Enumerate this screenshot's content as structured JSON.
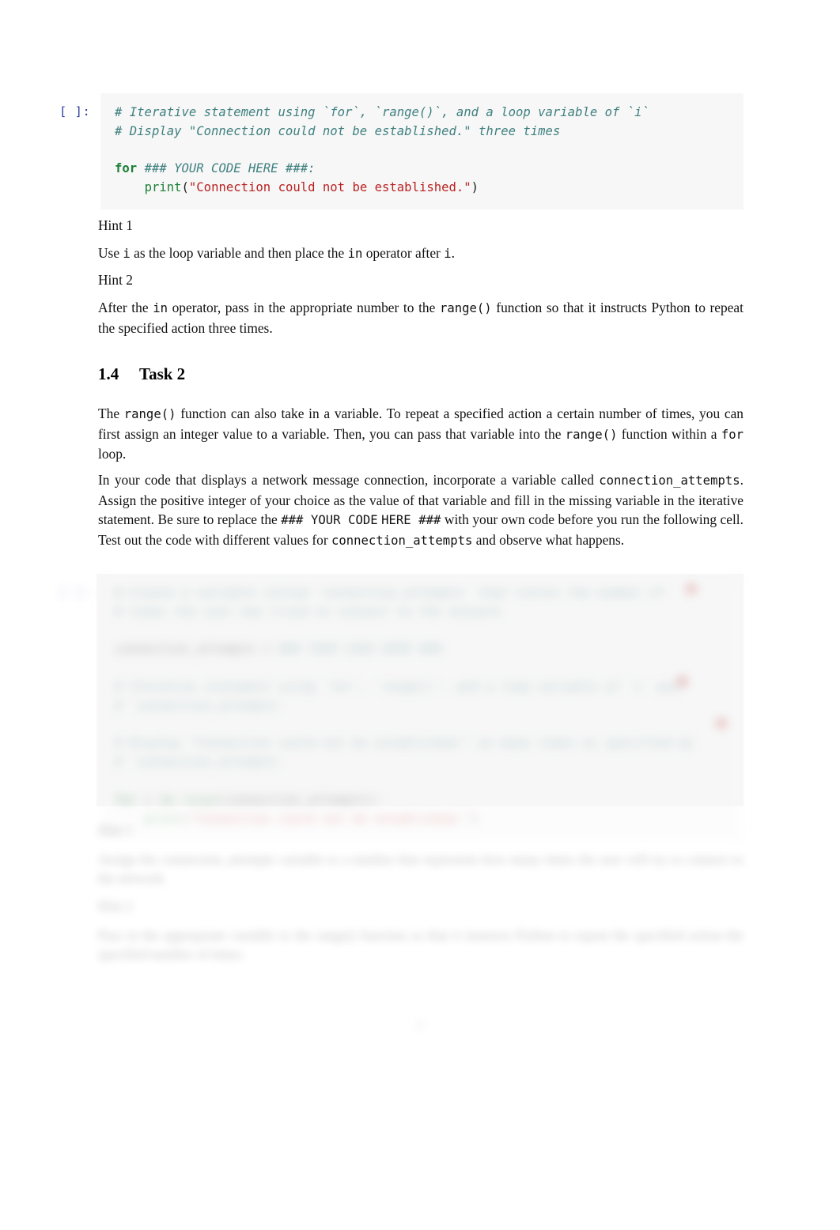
{
  "document": {
    "kind": "jupyter-notebook-pdf-export",
    "page_number": "2"
  },
  "cell1": {
    "prompt": "[ ]:",
    "lines": [
      {
        "segments": [
          {
            "type": "comment",
            "text": "# Iterative statement using `for`, `range()`, and a loop variable of `i`"
          }
        ]
      },
      {
        "segments": [
          {
            "type": "comment",
            "text": "# Display \"Connection could not be established.\" three times"
          }
        ]
      },
      {
        "segments": [
          {
            "type": "plain",
            "text": ""
          }
        ]
      },
      {
        "segments": [
          {
            "type": "keyword",
            "text": "for"
          },
          {
            "type": "plain",
            "text": " "
          },
          {
            "type": "comment",
            "text": "### YOUR CODE HERE ###:"
          }
        ]
      },
      {
        "segments": [
          {
            "type": "plain",
            "text": "    "
          },
          {
            "type": "function",
            "text": "print"
          },
          {
            "type": "plain",
            "text": "("
          },
          {
            "type": "string",
            "text": "\"Connection could not be established.\""
          },
          {
            "type": "plain",
            "text": ")"
          }
        ]
      }
    ]
  },
  "hint1": {
    "title": "Hint 1",
    "body_parts": [
      {
        "type": "text",
        "text": "Use "
      },
      {
        "type": "code",
        "text": "i"
      },
      {
        "type": "text",
        "text": " as the loop variable and then place the "
      },
      {
        "type": "code",
        "text": "in"
      },
      {
        "type": "text",
        "text": " operator after "
      },
      {
        "type": "code",
        "text": "i"
      },
      {
        "type": "text",
        "text": "."
      }
    ]
  },
  "hint2": {
    "title": "Hint 2",
    "body_parts": [
      {
        "type": "text",
        "text": "After the "
      },
      {
        "type": "code",
        "text": "in"
      },
      {
        "type": "text",
        "text": " operator, pass in the appropriate number to the "
      },
      {
        "type": "code",
        "text": "range()"
      },
      {
        "type": "text",
        "text": " function so that it instructs Python to repeat the specified action three times."
      }
    ]
  },
  "section": {
    "number": "1.4",
    "title": "Task 2"
  },
  "para1": {
    "parts": [
      {
        "type": "text",
        "text": "The "
      },
      {
        "type": "code",
        "text": "range()"
      },
      {
        "type": "text",
        "text": " function can also take in a variable. To repeat a specified action a certain number of times, you can first assign an integer value to a variable. Then, you can pass that variable into the "
      },
      {
        "type": "code",
        "text": "range()"
      },
      {
        "type": "text",
        "text": " function within a "
      },
      {
        "type": "code",
        "text": "for"
      },
      {
        "type": "text",
        "text": " loop."
      }
    ]
  },
  "para2": {
    "parts": [
      {
        "type": "text",
        "text": "In your code that displays a network message connection, incorporate a variable called "
      },
      {
        "type": "code",
        "text": "connection_attempts"
      },
      {
        "type": "text",
        "text": ". Assign the positive integer of your choice as the value of that variable and fill in the missing variable in the iterative statement. Be sure to replace the "
      },
      {
        "type": "code",
        "text": "### YOUR CODE"
      },
      {
        "type": "text",
        "text": " "
      },
      {
        "type": "code",
        "text": "HERE ###"
      },
      {
        "type": "text",
        "text": " with your own code before you run the following cell. Test out the code with different values for "
      },
      {
        "type": "code",
        "text": "connection_attempts"
      },
      {
        "type": "text",
        "text": " and observe what happens."
      }
    ]
  },
  "redacted": {
    "note": "blurred-content",
    "cell": {
      "prompt": "[ ]:",
      "lines": [
        {
          "segments": [
            {
              "type": "comment",
              "text": "# Create a variable called `connection_attempts` that stores the number of"
            }
          ]
        },
        {
          "segments": [
            {
              "type": "comment",
              "text": "# times the user has tried to connect to the network"
            }
          ]
        },
        {
          "segments": [
            {
              "type": "plain",
              "text": ""
            }
          ]
        },
        {
          "segments": [
            {
              "type": "plain",
              "text": "connection_attempts"
            },
            {
              "type": "plain",
              "text": " = "
            },
            {
              "type": "comment",
              "text": "### YOUR CODE HERE ###"
            }
          ]
        },
        {
          "segments": [
            {
              "type": "plain",
              "text": ""
            }
          ]
        },
        {
          "segments": [
            {
              "type": "comment",
              "text": "# Iterative statement using `for`, `range()`, and a loop variable of `i` and"
            }
          ]
        },
        {
          "segments": [
            {
              "type": "comment",
              "text": "# `connection_attempts`"
            }
          ]
        },
        {
          "segments": [
            {
              "type": "plain",
              "text": ""
            }
          ]
        },
        {
          "segments": [
            {
              "type": "comment",
              "text": "# Display \"Connection could not be established.\" as many times as specified by"
            }
          ]
        },
        {
          "segments": [
            {
              "type": "comment",
              "text": "# `connection_attempts`"
            }
          ]
        },
        {
          "segments": [
            {
              "type": "plain",
              "text": ""
            }
          ]
        },
        {
          "segments": [
            {
              "type": "keyword",
              "text": "for"
            },
            {
              "type": "plain",
              "text": " i "
            },
            {
              "type": "keyword",
              "text": "in"
            },
            {
              "type": "plain",
              "text": " "
            },
            {
              "type": "function",
              "text": "range"
            },
            {
              "type": "plain",
              "text": "(connection_attempts):"
            }
          ]
        },
        {
          "segments": [
            {
              "type": "plain",
              "text": "    "
            },
            {
              "type": "function",
              "text": "print"
            },
            {
              "type": "plain",
              "text": "("
            },
            {
              "type": "string",
              "text": "\"Connection could not be established.\""
            },
            {
              "type": "plain",
              "text": ")"
            }
          ]
        }
      ]
    },
    "hint3": {
      "title": "Hint 1",
      "body": "Assign the connection_attempts variable to a number that represents how many times the user will try to connect to the network."
    },
    "hint4": {
      "title": "Hint 2",
      "body": "Pass in the appropriate variable to the range() function so that it instructs Python to repeat the specified action the specified number of times."
    }
  }
}
